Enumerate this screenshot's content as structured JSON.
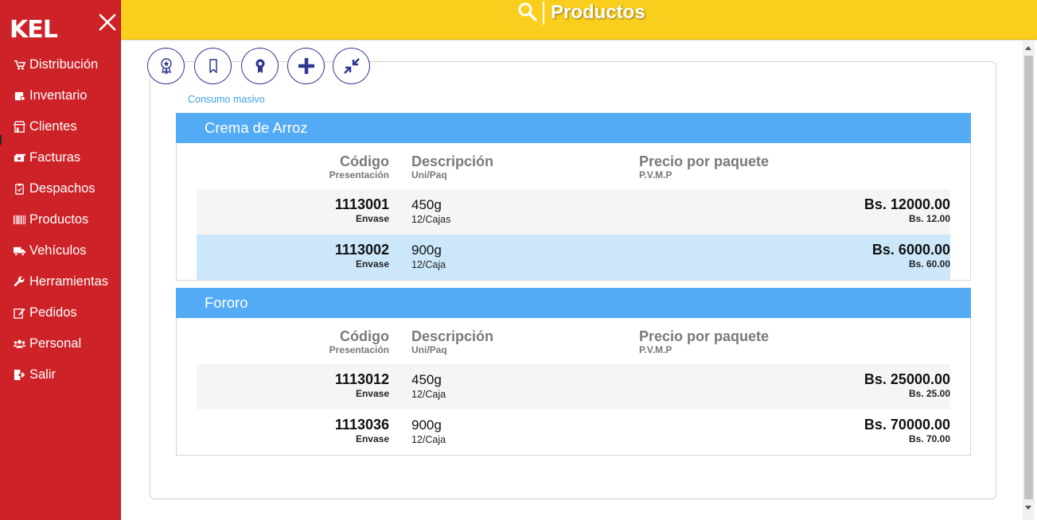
{
  "brand": "KEL",
  "nav": [
    {
      "label": "Distribución",
      "icon": "distribution-icon"
    },
    {
      "label": "Inventario",
      "icon": "inventory-icon"
    },
    {
      "label": "Clientes",
      "icon": "store-icon"
    },
    {
      "label": "Facturas",
      "icon": "money-icon"
    },
    {
      "label": "Despachos",
      "icon": "clipboard-icon"
    },
    {
      "label": "Productos",
      "icon": "barcode-icon"
    },
    {
      "label": "Vehículos",
      "icon": "truck-icon"
    },
    {
      "label": "Herramientas",
      "icon": "wrench-icon"
    },
    {
      "label": "Pedidos",
      "icon": "edit-icon"
    },
    {
      "label": "Personal",
      "icon": "users-icon"
    },
    {
      "label": "Salir",
      "icon": "sign-out-icon"
    }
  ],
  "topbar": {
    "title": "Productos",
    "search_icon": "search-icon"
  },
  "toolbar": {
    "buttons": [
      "award-icon",
      "bookmark-icon",
      "ribbon-icon",
      "plus-icon",
      "compress-icon"
    ],
    "accent": "#2f3791"
  },
  "category": "Consumo masivo",
  "columns": {
    "code": "Código",
    "code_sub": "Presentación",
    "desc": "Descripción",
    "desc_sub": "Uni/Paq",
    "price": "Precio por paquete",
    "price_sub": "P.V.M.P"
  },
  "groups": [
    {
      "name": "Crema de Arroz",
      "products": [
        {
          "code": "1113001",
          "presentation": "Envase",
          "desc": "450g",
          "units": "12/Cajas",
          "price": "Bs. 12000.00",
          "unit_price": "Bs. 12.00"
        },
        {
          "code": "1113002",
          "presentation": "Envase",
          "desc": "900g",
          "units": "12/Caja",
          "price": "Bs. 6000.00",
          "unit_price": "Bs. 60.00"
        }
      ]
    },
    {
      "name": "Fororo",
      "products": [
        {
          "code": "1113012",
          "presentation": "Envase",
          "desc": "450g",
          "units": "12/Caja",
          "price": "Bs. 25000.00",
          "unit_price": "Bs. 25.00"
        },
        {
          "code": "1113036",
          "presentation": "Envase",
          "desc": "900g",
          "units": "12/Caja",
          "price": "Bs. 70000.00",
          "unit_price": "Bs. 70.00"
        }
      ]
    }
  ],
  "colors": {
    "sidebar": "#cd2227",
    "topbar": "#f9ce1d",
    "group_header": "#53abf6",
    "selected_row": "#cce7fa"
  }
}
